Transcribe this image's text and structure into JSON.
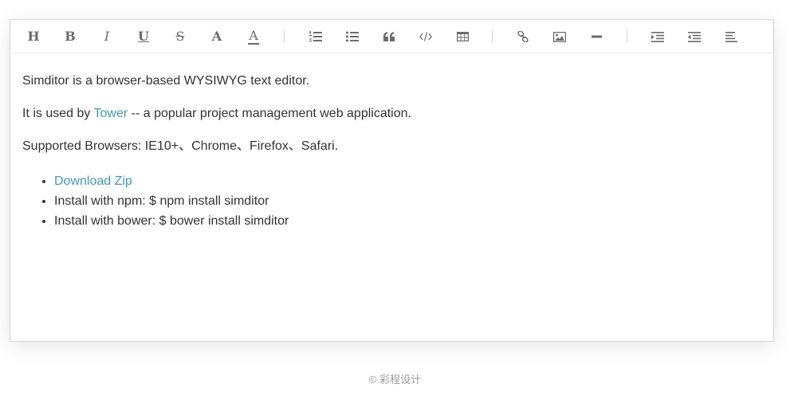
{
  "toolbar": {
    "title": "H",
    "bold": "B",
    "italic": "I",
    "underline": "U",
    "strikethrough": "S",
    "fontColor": "A",
    "bgColor": "A"
  },
  "content": {
    "p1": "Simditor is a browser-based WYSIWYG text editor.",
    "p2_before": "It is used by ",
    "p2_link": "Tower",
    "p2_after": " -- a popular project management web application.",
    "p3": "Supported Browsers: IE10+、Chrome、Firefox、Safari.",
    "list": [
      {
        "link": "Download Zip"
      },
      {
        "text": "Install with npm: $ npm install simditor"
      },
      {
        "text": "Install with bower: $ bower install simditor"
      }
    ]
  },
  "footer": "© 彩程设计",
  "colors": {
    "link": "#4298ba",
    "icon": "#6b6b6b",
    "text": "#333333"
  }
}
